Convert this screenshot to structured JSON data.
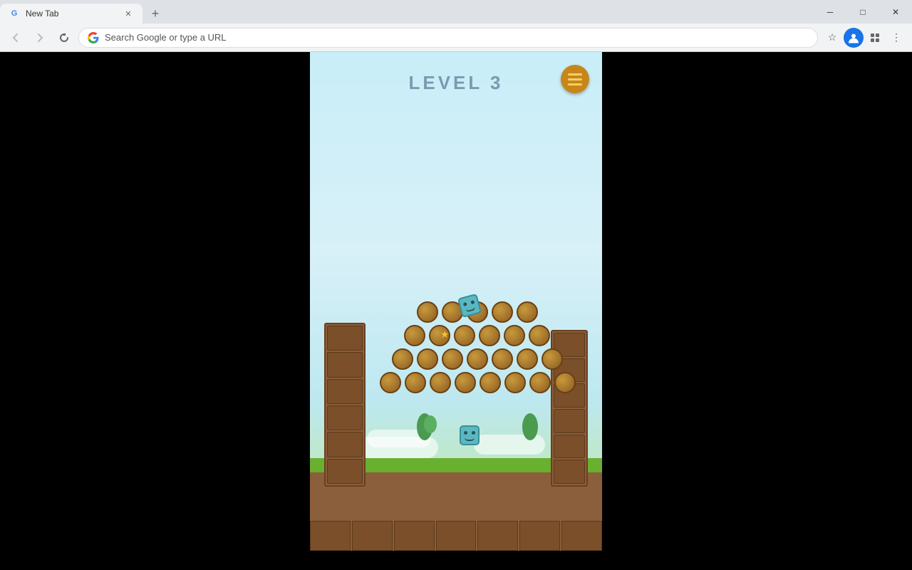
{
  "browser": {
    "tab_title": "New Tab",
    "new_tab_label": "+",
    "url_placeholder": "Search Google or type a URL",
    "url_text": "Search Google or type a URL",
    "minimize_label": "─",
    "maximize_label": "□",
    "close_label": "✕",
    "back_label": "←",
    "forward_label": "→",
    "refresh_label": "↻"
  },
  "game": {
    "level_text": "LEVEL  3",
    "menu_icon": "menu-icon"
  }
}
